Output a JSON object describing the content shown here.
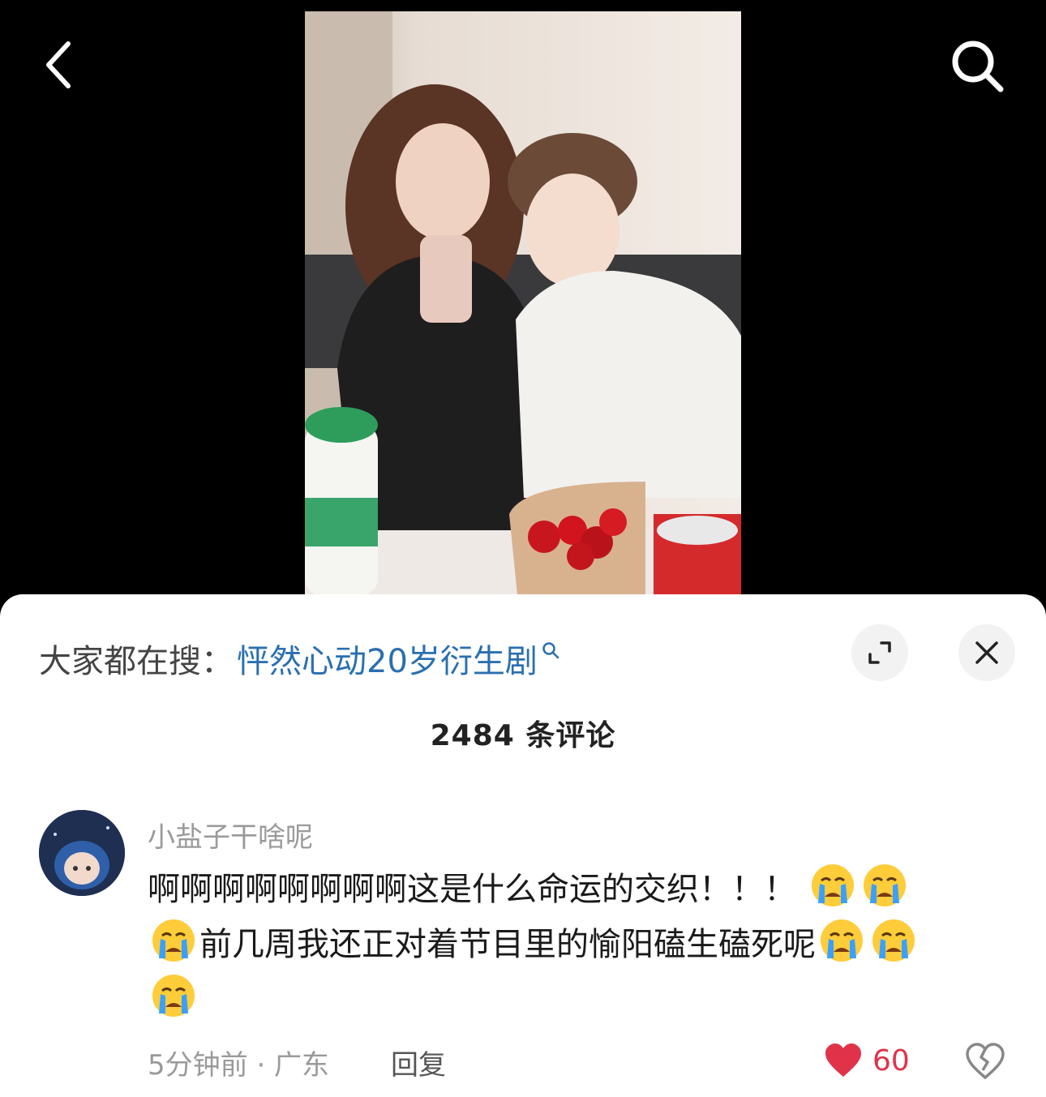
{
  "nav": {
    "back_icon": "chevron-left-icon",
    "search_icon": "search-icon"
  },
  "trending": {
    "prefix": "大家都在搜：",
    "query": "怦然心动20岁衍生剧",
    "icon": "search-icon"
  },
  "sheet": {
    "expand_icon": "expand-icon",
    "close_icon": "close-icon",
    "comment_count": "2484 条评论"
  },
  "comment": {
    "username": "小盐子干啥呢",
    "text_part1": "啊啊啊啊啊啊啊啊这是什么命运的交织！！！",
    "text_part2": "前几周我还正对着节目里的愉阳磕生磕死呢",
    "emoji": "loudly-crying-emoji",
    "time_location": "5分钟前 · 广东",
    "reply_label": "回复",
    "like_count": "60",
    "colors": {
      "like": "#e0334a",
      "link": "#2a6fb0"
    }
  }
}
